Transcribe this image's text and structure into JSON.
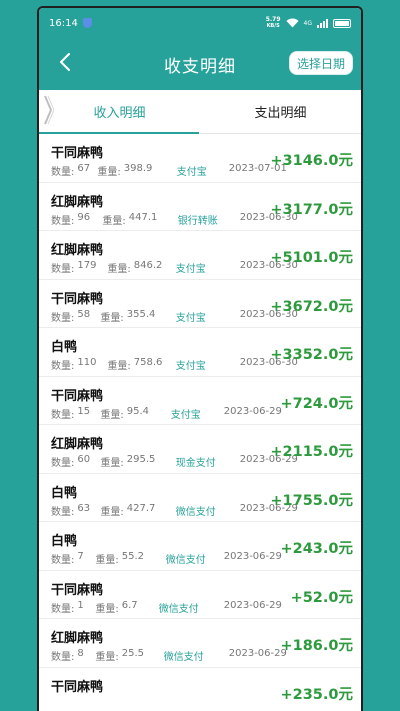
{
  "status": {
    "time": "16:14",
    "speed_value": "5.79",
    "speed_unit": "KB/S",
    "network": "4G"
  },
  "header": {
    "title": "收支明细",
    "date_button": "选择日期"
  },
  "tabs": [
    {
      "label": "收入明细",
      "active": true
    },
    {
      "label": "支出明细",
      "active": false
    }
  ],
  "labels": {
    "qty": "数量:",
    "weight": "重量:"
  },
  "colors": {
    "accent": "#27a29a",
    "amount": "#2e9a3e"
  },
  "records": [
    {
      "name": "干同麻鸭",
      "qty": "67",
      "weight": "398.9",
      "pay": "支付宝",
      "date": "2023-07-01",
      "amount": "+3146.0元"
    },
    {
      "name": "红脚麻鸭",
      "qty": "96",
      "weight": "447.1",
      "pay": "银行转账",
      "date": "2023-06-30",
      "amount": "+3177.0元"
    },
    {
      "name": "红脚麻鸭",
      "qty": "179",
      "weight": "846.2",
      "pay": "支付宝",
      "date": "2023-06-30",
      "amount": "+5101.0元"
    },
    {
      "name": "干同麻鸭",
      "qty": "58",
      "weight": "355.4",
      "pay": "支付宝",
      "date": "2023-06-30",
      "amount": "+3672.0元"
    },
    {
      "name": "白鸭",
      "qty": "110",
      "weight": "758.6",
      "pay": "支付宝",
      "date": "2023-06-30",
      "amount": "+3352.0元"
    },
    {
      "name": "干同麻鸭",
      "qty": "15",
      "weight": "95.4",
      "pay": "支付宝",
      "date": "2023-06-29",
      "amount": "+724.0元"
    },
    {
      "name": "红脚麻鸭",
      "qty": "60",
      "weight": "295.5",
      "pay": "现金支付",
      "date": "2023-06-29",
      "amount": "+2115.0元"
    },
    {
      "name": "白鸭",
      "qty": "63",
      "weight": "427.7",
      "pay": "微信支付",
      "date": "2023-06-29",
      "amount": "+1755.0元"
    },
    {
      "name": "白鸭",
      "qty": "7",
      "weight": "55.2",
      "pay": "微信支付",
      "date": "2023-06-29",
      "amount": "+243.0元"
    },
    {
      "name": "干同麻鸭",
      "qty": "1",
      "weight": "6.7",
      "pay": "微信支付",
      "date": "2023-06-29",
      "amount": "+52.0元"
    },
    {
      "name": "红脚麻鸭",
      "qty": "8",
      "weight": "25.5",
      "pay": "微信支付",
      "date": "2023-06-29",
      "amount": "+186.0元"
    },
    {
      "name": "干同麻鸭",
      "qty": "",
      "weight": "",
      "pay": "",
      "date": "",
      "amount": "+235.0元"
    }
  ]
}
